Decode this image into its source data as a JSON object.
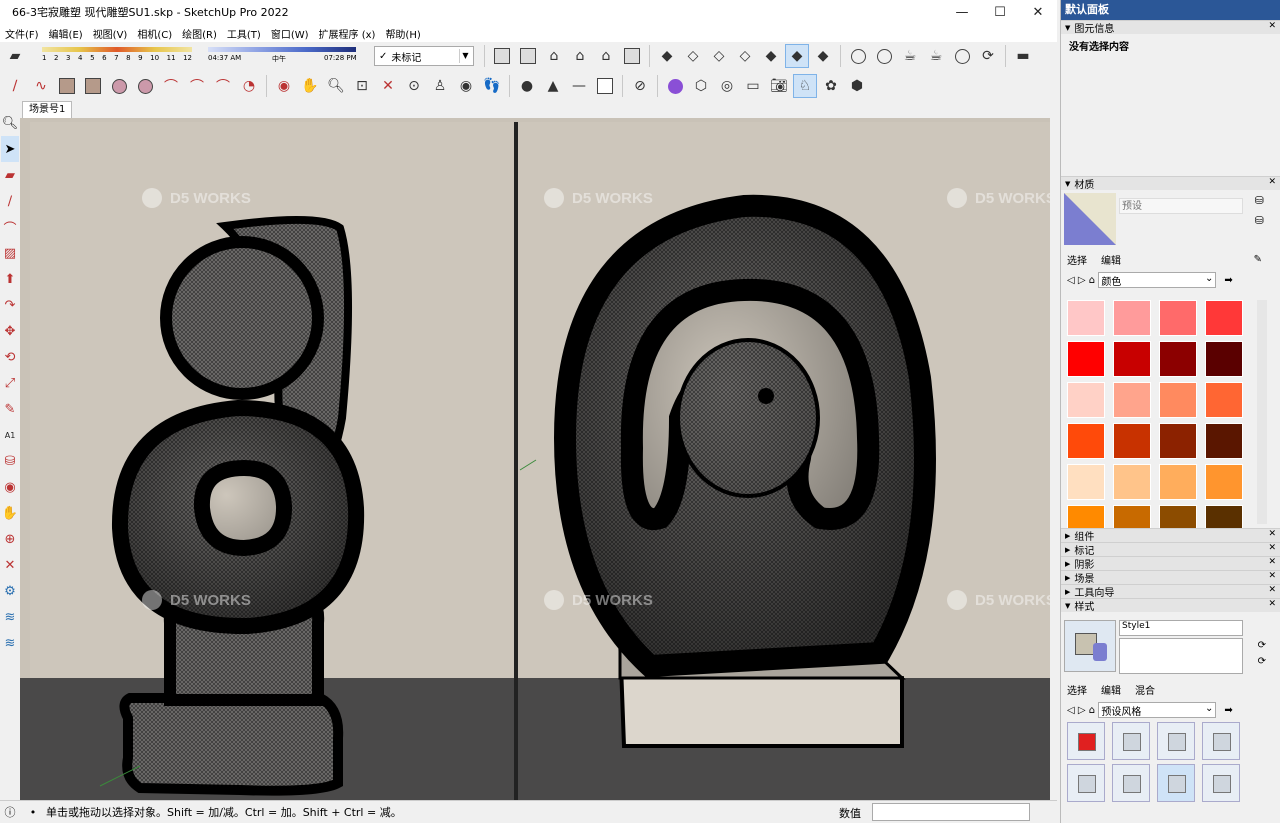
{
  "window": {
    "title": "66-3宅寂雕塑  现代雕塑SU1.skp - SketchUp Pro 2022",
    "controls": [
      "—",
      "☐",
      "✕"
    ]
  },
  "menu": [
    "文件(F)",
    "编辑(E)",
    "视图(V)",
    "相机(C)",
    "绘图(R)",
    "工具(T)",
    "窗口(W)",
    "扩展程序 (x)",
    "帮助(H)"
  ],
  "sun": {
    "months": [
      "1",
      "2",
      "3",
      "4",
      "5",
      "6",
      "7",
      "8",
      "9",
      "10",
      "11",
      "12"
    ],
    "time_start": "04:37 AM",
    "time_mid": "中午",
    "time_end": "07:28 PM",
    "bar_colors": [
      "#e7c54b",
      "#4a69c8"
    ]
  },
  "tag_dropdown": {
    "value": "未标记"
  },
  "scene_tab": "场景号1",
  "watermark": "D5 WORKS",
  "panel": {
    "title": "默认面板",
    "entity_info": {
      "header": "图元信息",
      "text": "没有选择内容"
    },
    "materials": {
      "header": "材质",
      "name_placeholder": "预设",
      "tabs": [
        "选择",
        "编辑"
      ],
      "library": "颜色",
      "swatches": [
        "#ffc7c7",
        "#ff9b9b",
        "#ff6a6a",
        "#ff3838",
        "#ff0000",
        "#c80000",
        "#8c0000",
        "#5a0000",
        "#ffd1c6",
        "#ffa48c",
        "#ff8a5f",
        "#ff6633",
        "#ff4a0a",
        "#c83200",
        "#8c2200",
        "#5a1600",
        "#ffdfc0",
        "#ffc48a",
        "#ffad5c",
        "#ff952e",
        "#ff8a00",
        "#c86a00",
        "#8c4c00",
        "#5a3000"
      ]
    },
    "sections": [
      "组件",
      "标记",
      "阴影",
      "场景",
      "工具向导",
      "样式"
    ],
    "styles": {
      "name": "Style1",
      "tabs": [
        "选择",
        "编辑",
        "混合"
      ],
      "library": "预设风格"
    }
  },
  "status": {
    "hint": "单击或拖动以选择对象。Shift = 加/减。Ctrl = 加。Shift + Ctrl = 减。",
    "measure_label": "数值"
  }
}
